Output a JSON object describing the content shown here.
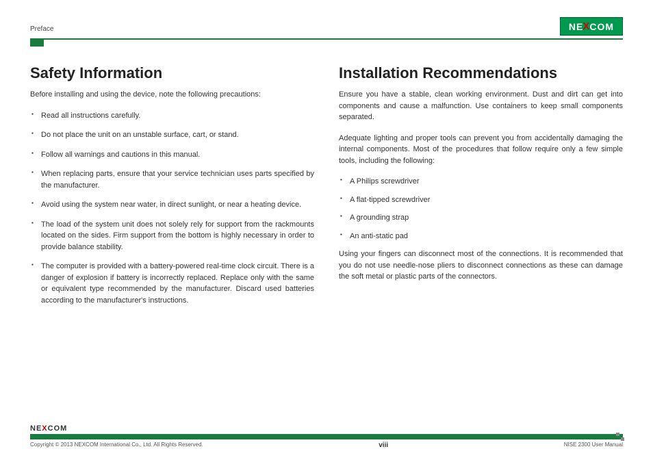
{
  "header": {
    "section": "Preface",
    "logo_pre": "NE",
    "logo_x": "X",
    "logo_post": "COM"
  },
  "left": {
    "title": "Safety Information",
    "intro": "Before installing and using the device, note the following precautions:",
    "items": [
      "Read all instructions carefully.",
      "Do not place the unit on an unstable surface, cart, or stand.",
      "Follow all warnings and cautions in this manual.",
      "When replacing parts, ensure that your service technician uses parts specified by the manufacturer.",
      "Avoid using the system near water, in direct sunlight, or near a heating device.",
      "The load of the system unit does not solely rely for support from the rackmounts located on the sides. Firm support from the bottom is highly necessary in order to provide balance stability.",
      "The computer is provided with a battery-powered real-time clock circuit. There is a danger of explosion if battery is incorrectly replaced. Replace only with the same or equivalent type recommended by the manufacturer. Discard used batteries according to the manufacturer's instructions."
    ]
  },
  "right": {
    "title": "Installation Recommendations",
    "p1": "Ensure you have a stable, clean working environment. Dust and dirt can get into components and cause a malfunction. Use containers to keep small components separated.",
    "p2": "Adequate lighting and proper tools can prevent you from accidentally damaging the internal components. Most of the procedures that follow require only a few simple tools, including the following:",
    "items": [
      "A Philips screwdriver",
      "A flat-tipped screwdriver",
      "A grounding strap",
      "An anti-static pad"
    ],
    "p3": "Using your fingers can disconnect most of the connections. It is recommended that you do not use needle-nose pliers to disconnect connections as these can damage the soft metal or plastic parts of the connectors."
  },
  "footer": {
    "logo_pre": "NE",
    "logo_x": "X",
    "logo_post": "COM",
    "copyright": "Copyright © 2013 NEXCOM International Co., Ltd. All Rights Reserved.",
    "page": "viii",
    "doc": "NISE 2300 User Manual"
  }
}
